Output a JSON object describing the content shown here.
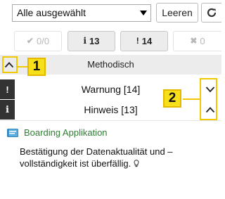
{
  "filter": {
    "select_value": "Alle ausgewählt",
    "clear_label": "Leeren"
  },
  "counters": {
    "ok": "0/0",
    "info": "13",
    "warning": "14",
    "error": "0"
  },
  "group": {
    "title": "Methodisch"
  },
  "categories": [
    {
      "label": "Warnung [14]",
      "marker": "!",
      "chevron": "down"
    },
    {
      "label": "Hinweis [13]",
      "marker": "i",
      "chevron": "up"
    }
  ],
  "item": {
    "title": "Boarding Applikation",
    "body": "Bestätigung der Datenaktualität und – vollständigkeit ist überfällig."
  },
  "callouts": {
    "one": "1",
    "two": "2"
  },
  "colors": {
    "highlight": "#f7e01a",
    "link_green": "#2e7d32",
    "marker_bar": "#333333"
  }
}
